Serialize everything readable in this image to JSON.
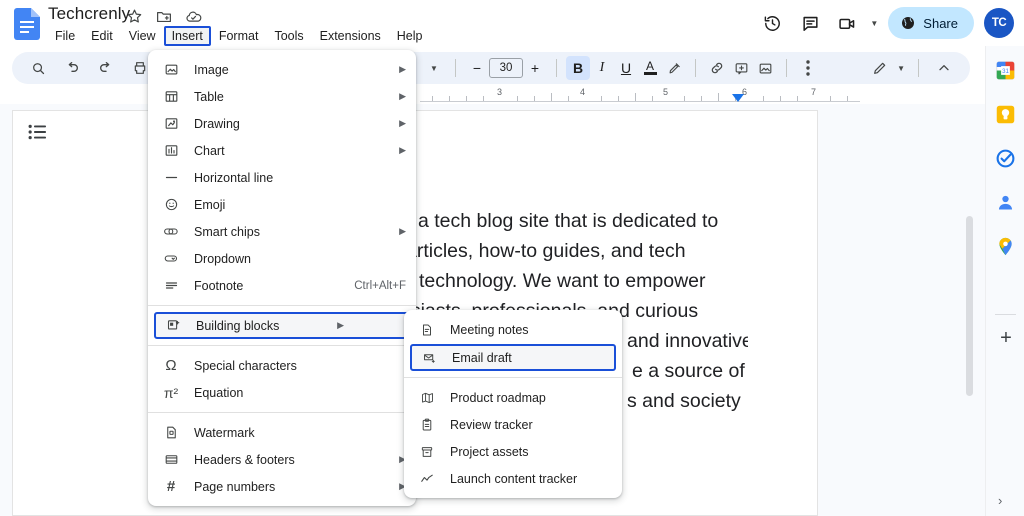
{
  "app": {
    "name": "Google Docs"
  },
  "header": {
    "doc_icon": "docs-file-icon",
    "title": "Techcrenly",
    "title_icons": [
      {
        "name": "star-icon",
        "label": "Star"
      },
      {
        "name": "move-to-folder-icon",
        "label": "Move"
      },
      {
        "name": "cloud-saved-icon",
        "label": "Saved to Drive"
      }
    ],
    "menus": [
      {
        "name": "menu-file",
        "label": "File",
        "selected": false
      },
      {
        "name": "menu-edit",
        "label": "Edit",
        "selected": false
      },
      {
        "name": "menu-view",
        "label": "View",
        "selected": false
      },
      {
        "name": "menu-insert",
        "label": "Insert",
        "selected": true
      },
      {
        "name": "menu-format",
        "label": "Format",
        "selected": false
      },
      {
        "name": "menu-tools",
        "label": "Tools",
        "selected": false
      },
      {
        "name": "menu-extensions",
        "label": "Extensions",
        "selected": false
      },
      {
        "name": "menu-help",
        "label": "Help",
        "selected": false
      }
    ],
    "right_actions": [
      {
        "name": "version-history-icon",
        "label": "Last edit"
      },
      {
        "name": "comment-icon",
        "label": "Open comment history"
      },
      {
        "name": "meet-icon",
        "label": "Join a call"
      }
    ],
    "share": {
      "label": "Share",
      "icon": "globe-icon",
      "bg_color": "#c2e7ff"
    },
    "avatar": {
      "initials": "TC",
      "bg_color": "#1a56c4"
    }
  },
  "toolbar": {
    "bg_color": "#edf2fa",
    "left_icons": [
      {
        "name": "search-icon"
      },
      {
        "name": "undo-icon"
      },
      {
        "name": "redo-icon"
      },
      {
        "name": "print-icon"
      },
      {
        "name": "spellcheck-icon"
      }
    ],
    "font_size": "30",
    "decrease_label": "−",
    "increase_label": "+",
    "bold_label": "B",
    "italic_label": "I",
    "underline_label": "U",
    "text_color_label": "A",
    "right_icons": [
      {
        "name": "highlight-icon"
      },
      {
        "name": "link-icon"
      },
      {
        "name": "add-comment-icon"
      },
      {
        "name": "insert-image-icon"
      },
      {
        "name": "more-options-icon"
      },
      {
        "name": "editing-mode-icon"
      },
      {
        "name": "collapse-toolbar-icon"
      }
    ]
  },
  "ruler": {
    "numbers": [
      "3",
      "4",
      "5",
      "6",
      "7"
    ],
    "indent_marker": "left-indent-marker"
  },
  "document": {
    "outline_icon": "document-outline-icon",
    "lines": [
      "a tech blog site that is dedicated to",
      "articles,   how-to   guides,   and   tech",
      "technology.  We  want  to  empower",
      "usiasts,   professionals,   and   curious",
      "and  innovative",
      "e a source of",
      "s and society"
    ]
  },
  "insert_menu": {
    "name": "insert-dropdown",
    "groups": [
      {
        "items": [
          {
            "name": "menu-item-image",
            "icon": "image-icon",
            "label": "Image",
            "arrow": true,
            "accel": ""
          },
          {
            "name": "menu-item-table",
            "icon": "table-icon",
            "label": "Table",
            "arrow": true,
            "accel": ""
          },
          {
            "name": "menu-item-drawing",
            "icon": "drawing-icon",
            "label": "Drawing",
            "arrow": true,
            "accel": ""
          },
          {
            "name": "menu-item-chart",
            "icon": "chart-icon",
            "label": "Chart",
            "arrow": true,
            "accel": ""
          },
          {
            "name": "menu-item-horizontal-line",
            "icon": "horizontal-line-icon",
            "label": "Horizontal line",
            "arrow": false,
            "accel": ""
          },
          {
            "name": "menu-item-emoji",
            "icon": "emoji-icon",
            "label": "Emoji",
            "arrow": false,
            "accel": ""
          },
          {
            "name": "menu-item-smart-chips",
            "icon": "smart-chips-icon",
            "label": "Smart chips",
            "arrow": true,
            "accel": ""
          },
          {
            "name": "menu-item-dropdown",
            "icon": "dropdown-icon",
            "label": "Dropdown",
            "arrow": false,
            "accel": ""
          },
          {
            "name": "menu-item-footnote",
            "icon": "footnote-icon",
            "label": "Footnote",
            "arrow": false,
            "accel": "Ctrl+Alt+F"
          }
        ]
      },
      {
        "items": [
          {
            "name": "menu-item-building-blocks",
            "icon": "building-blocks-icon",
            "label": "Building blocks",
            "arrow": true,
            "accel": "",
            "highlighted": true
          }
        ]
      },
      {
        "items": [
          {
            "name": "menu-item-special-characters",
            "icon": "omega-icon",
            "label": "Special characters",
            "arrow": false,
            "accel": ""
          },
          {
            "name": "menu-item-equation",
            "icon": "equation-icon",
            "label": "Equation",
            "arrow": false,
            "accel": ""
          }
        ]
      },
      {
        "items": [
          {
            "name": "menu-item-watermark",
            "icon": "watermark-icon",
            "label": "Watermark",
            "arrow": false,
            "accel": ""
          },
          {
            "name": "menu-item-headers-footers",
            "icon": "headers-footers-icon",
            "label": "Headers & footers",
            "arrow": true,
            "accel": ""
          },
          {
            "name": "menu-item-page-numbers",
            "icon": "page-numbers-icon",
            "label": "Page numbers",
            "arrow": true,
            "accel": ""
          }
        ]
      }
    ]
  },
  "building_blocks_submenu": {
    "name": "building-blocks-submenu",
    "groups": [
      {
        "items": [
          {
            "name": "submenu-item-meeting-notes",
            "icon": "meeting-notes-icon",
            "label": "Meeting notes",
            "highlighted": false
          },
          {
            "name": "submenu-item-email-draft",
            "icon": "email-draft-icon",
            "label": "Email draft",
            "highlighted": true
          }
        ]
      },
      {
        "items": [
          {
            "name": "submenu-item-product-roadmap",
            "icon": "product-roadmap-icon",
            "label": "Product roadmap",
            "highlighted": false
          },
          {
            "name": "submenu-item-review-tracker",
            "icon": "review-tracker-icon",
            "label": "Review tracker",
            "highlighted": false
          },
          {
            "name": "submenu-item-project-assets",
            "icon": "project-assets-icon",
            "label": "Project assets",
            "highlighted": false
          },
          {
            "name": "submenu-item-launch-content-tracker",
            "icon": "launch-content-tracker-icon",
            "label": "Launch content tracker",
            "highlighted": false
          }
        ]
      }
    ]
  },
  "side_rail": {
    "items": [
      {
        "name": "google-calendar-icon",
        "label": "Calendar"
      },
      {
        "name": "google-keep-icon",
        "label": "Keep"
      },
      {
        "name": "google-tasks-icon",
        "label": "Tasks"
      },
      {
        "name": "google-contacts-icon",
        "label": "Contacts"
      },
      {
        "name": "google-maps-icon",
        "label": "Maps"
      }
    ],
    "add_label": "+",
    "expand_label": "›"
  },
  "colors": {
    "accent_blue": "#1a4fd8",
    "toolbar_bg": "#edf2fa",
    "share_bg": "#c2e7ff",
    "canvas_bg": "#f8fafd"
  }
}
